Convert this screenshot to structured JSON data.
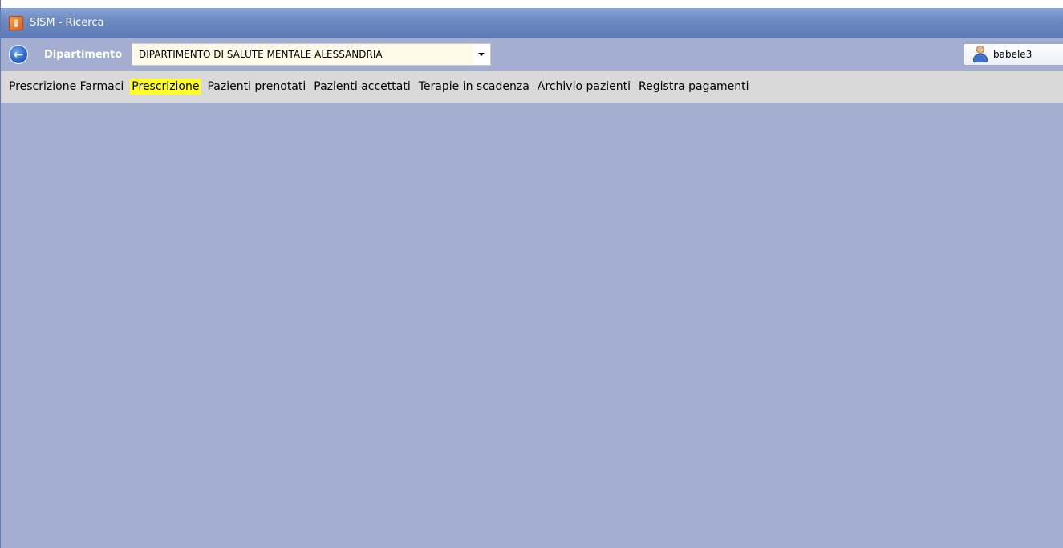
{
  "window": {
    "title": "SISM - Ricerca",
    "title_chevron": "›"
  },
  "toolbar": {
    "back_icon": "back-arrow-icon",
    "back_glyph": "←",
    "department_label": "Dipartimento",
    "department_value": "DIPARTIMENTO DI SALUTE MENTALE ALESSANDRIA",
    "user_icon": "user-icon",
    "user_name": "babele3"
  },
  "menu": {
    "items": [
      {
        "label": "Prescrizione Farmaci",
        "active": false
      },
      {
        "label": "Prescrizione",
        "active": true
      },
      {
        "label": "Pazienti prenotati",
        "active": false
      },
      {
        "label": "Pazienti accettati",
        "active": false
      },
      {
        "label": "Terapie in scadenza",
        "active": false
      },
      {
        "label": "Archivio pazienti",
        "active": false
      },
      {
        "label": "Registra pagamenti",
        "active": false
      }
    ]
  },
  "colors": {
    "background": "#a3aed0",
    "menubar": "#d9d9d9",
    "highlight": "#ffff26",
    "titlebar": "#6b88c0"
  }
}
